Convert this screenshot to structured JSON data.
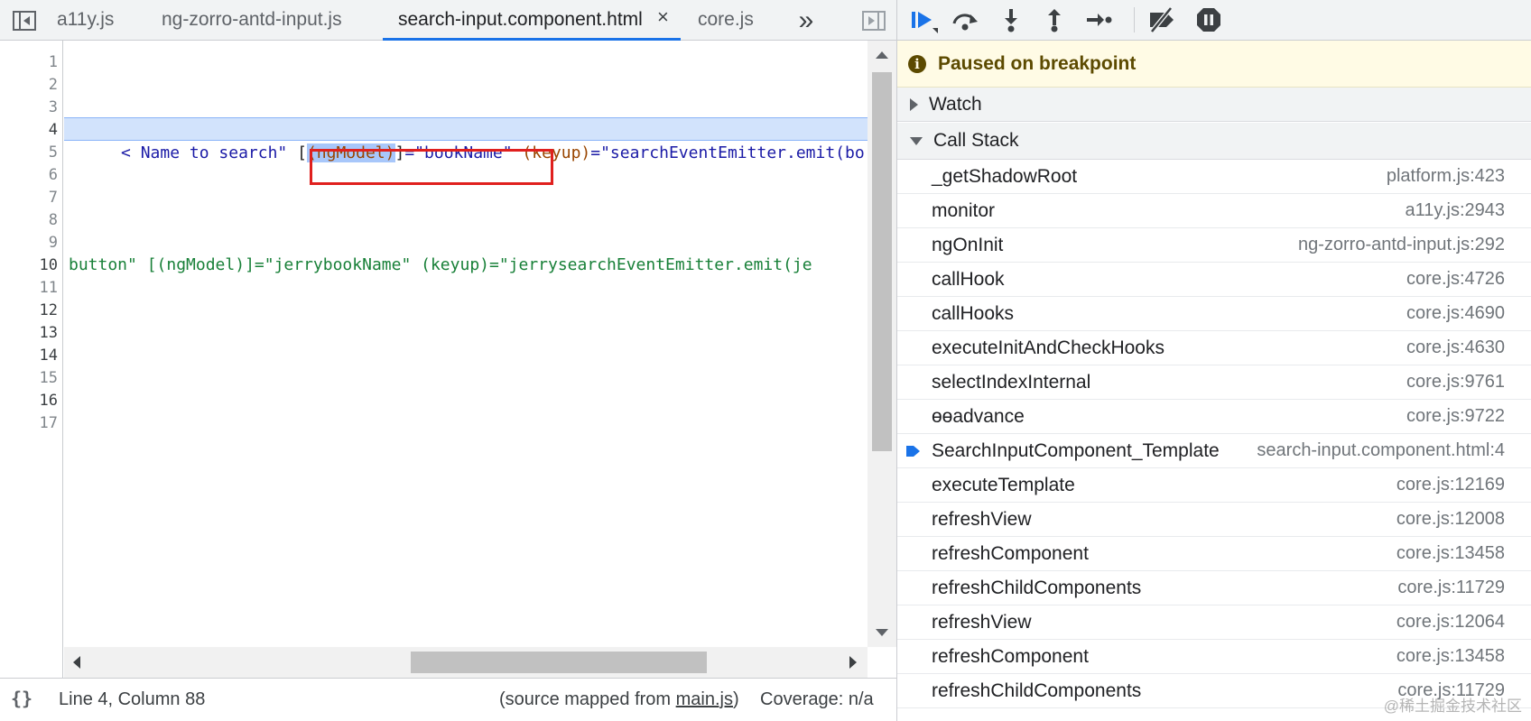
{
  "editor": {
    "tabs": [
      {
        "label": "a11y.js"
      },
      {
        "label": "ng-zorro-antd-input.js"
      },
      {
        "label": "search-input.component.html",
        "active": true,
        "closable": true
      },
      {
        "label": "core.js"
      }
    ],
    "close_glyph": "×",
    "overflow_glyph": "»",
    "line_numbers": [
      "1",
      "2",
      "3",
      "4",
      "5",
      "6",
      "7",
      "8",
      "9",
      "10",
      "11",
      "12",
      "13",
      "14",
      "15",
      "16",
      "17"
    ],
    "line4": {
      "part1": "< Name to search\" ",
      "part2": "[",
      "part3": "(ngModel)",
      "part4": "]",
      "part5": "=\"bookName\" ",
      "part6": "(keyup)",
      "part7": "=\"searchEventEmitter.emit(bo"
    },
    "line10": "button\" [(ngModel)]=\"jerrybookName\" (keyup)=\"jerrysearchEventEmitter.emit(je"
  },
  "statusbar": {
    "braces": "{}",
    "position": "Line 4, Column 88",
    "source_prefix": "(source mapped from ",
    "source_file": "main.js",
    "source_suffix": ")",
    "coverage": "Coverage: n/a"
  },
  "debugger": {
    "paused_message": "Paused on breakpoint",
    "info_glyph": "i",
    "watch_label": "Watch",
    "callstack_label": "Call Stack",
    "frames": [
      {
        "name": "_getShadowRoot",
        "location": "platform.js:423"
      },
      {
        "name": "monitor",
        "location": "a11y.js:2943"
      },
      {
        "name": "ngOnInit",
        "location": "ng-zorro-antd-input.js:292"
      },
      {
        "name": "callHook",
        "location": "core.js:4726"
      },
      {
        "name": "callHooks",
        "location": "core.js:4690"
      },
      {
        "name": "executeInitAndCheckHooks",
        "location": "core.js:4630"
      },
      {
        "name": "selectIndexInternal",
        "location": "core.js:9761"
      },
      {
        "name": "ɵɵadvance",
        "location": "core.js:9722"
      },
      {
        "name": "SearchInputComponent_Template",
        "location": "search-input.component.html:4",
        "current": true
      },
      {
        "name": "executeTemplate",
        "location": "core.js:12169"
      },
      {
        "name": "refreshView",
        "location": "core.js:12008"
      },
      {
        "name": "refreshComponent",
        "location": "core.js:13458"
      },
      {
        "name": "refreshChildComponents",
        "location": "core.js:11729"
      },
      {
        "name": "refreshView",
        "location": "core.js:12064"
      },
      {
        "name": "refreshComponent",
        "location": "core.js:13458"
      },
      {
        "name": "refreshChildComponents",
        "location": "core.js:11729"
      }
    ]
  },
  "watermark": "@稀土掘金技术社区",
  "colors": {
    "accent": "#1a73e8",
    "paused_bg": "#fffbe5",
    "breakpoint_box": "#e0201e"
  }
}
